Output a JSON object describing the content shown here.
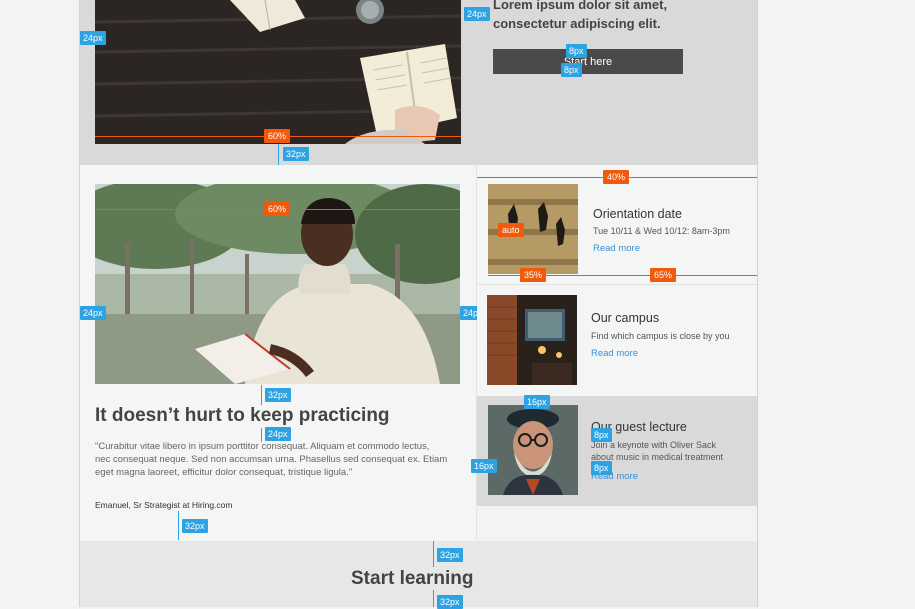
{
  "hero": {
    "heading_line1": "Lorem ipsum dolor sit amet,",
    "heading_line2": "consectetur adipiscing elit.",
    "button_label": "Start here"
  },
  "article": {
    "title": "It doesn’t hurt to keep practicing",
    "quote_line1": "\"Curabitur vitae libero in ipsum porttitor consequat. Aliquam et commodo lectus,",
    "quote_line2": "nec consequat neque. Sed non accumsan urna. Phasellus sed consequat ex. Etiam",
    "quote_line3": "eget magna laoreet, efficitur dolor consequat, tristique ligula.\"",
    "author": "Emanuel, Sr Strategist at Hiring.com"
  },
  "cards": [
    {
      "title": "Orientation date",
      "subtitle": "Tue 10/11 & Wed 10/12: 8am-3pm",
      "link": "Read more"
    },
    {
      "title": "Our campus",
      "subtitle": "Find which campus is close by you",
      "link": "Read more"
    },
    {
      "title": "Our guest lecture",
      "subtitle_line1": "Join a keynote with Oliver Sack",
      "subtitle_line2": "about music in medical treatment",
      "link": "Read more"
    }
  ],
  "footer": {
    "title": "Start learning"
  },
  "annotations": {
    "px24": "24px",
    "px32": "32px",
    "px8": "8px",
    "px16": "16px",
    "pct60": "60%",
    "pct40": "40%",
    "pct35": "35%",
    "pct65": "65%",
    "auto": "auto"
  },
  "colors": {
    "accent_blue": "#2ea3e3",
    "accent_orange": "#f15a0a",
    "link": "#3c8fd6"
  }
}
